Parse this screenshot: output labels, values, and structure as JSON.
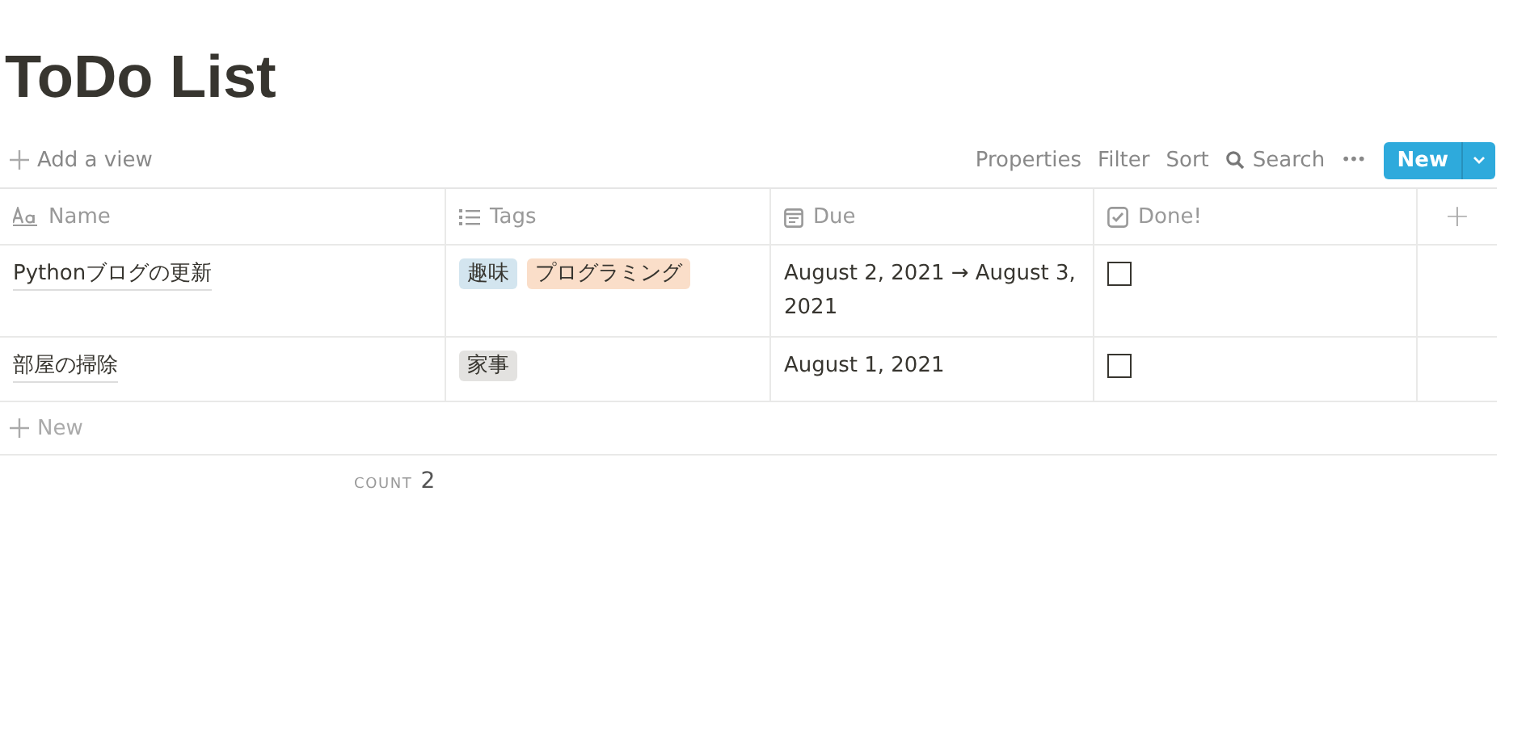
{
  "title": "ToDo List",
  "toolbar": {
    "add_view": "Add a view",
    "actions": [
      {
        "kind": "text",
        "label": "Properties"
      },
      {
        "kind": "text",
        "label": "Filter"
      },
      {
        "kind": "text",
        "label": "Sort"
      },
      {
        "kind": "search",
        "label": "Search"
      }
    ],
    "more": "•••",
    "new_button": "New"
  },
  "table": {
    "columns": [
      {
        "kind": "title",
        "label": "Name"
      },
      {
        "kind": "multi",
        "label": "Tags"
      },
      {
        "kind": "date",
        "label": "Due"
      },
      {
        "kind": "check",
        "label": "Done!"
      }
    ],
    "add_column": "+",
    "rows": [
      {
        "name": "Pythonブログの更新",
        "tags": [
          {
            "label": "趣味",
            "color": "#d3e5ef"
          },
          {
            "label": "プログラミング",
            "color": "#fadec9"
          }
        ],
        "due": "August 2, 2021 → August 3, 2021",
        "done": false
      },
      {
        "name": "部屋の掃除",
        "tags": [
          {
            "label": "家事",
            "color": "#e3e2e0"
          }
        ],
        "due": "August 1, 2021",
        "done": false
      }
    ],
    "new_row": "New",
    "count_label": "COUNT",
    "count": "2"
  }
}
